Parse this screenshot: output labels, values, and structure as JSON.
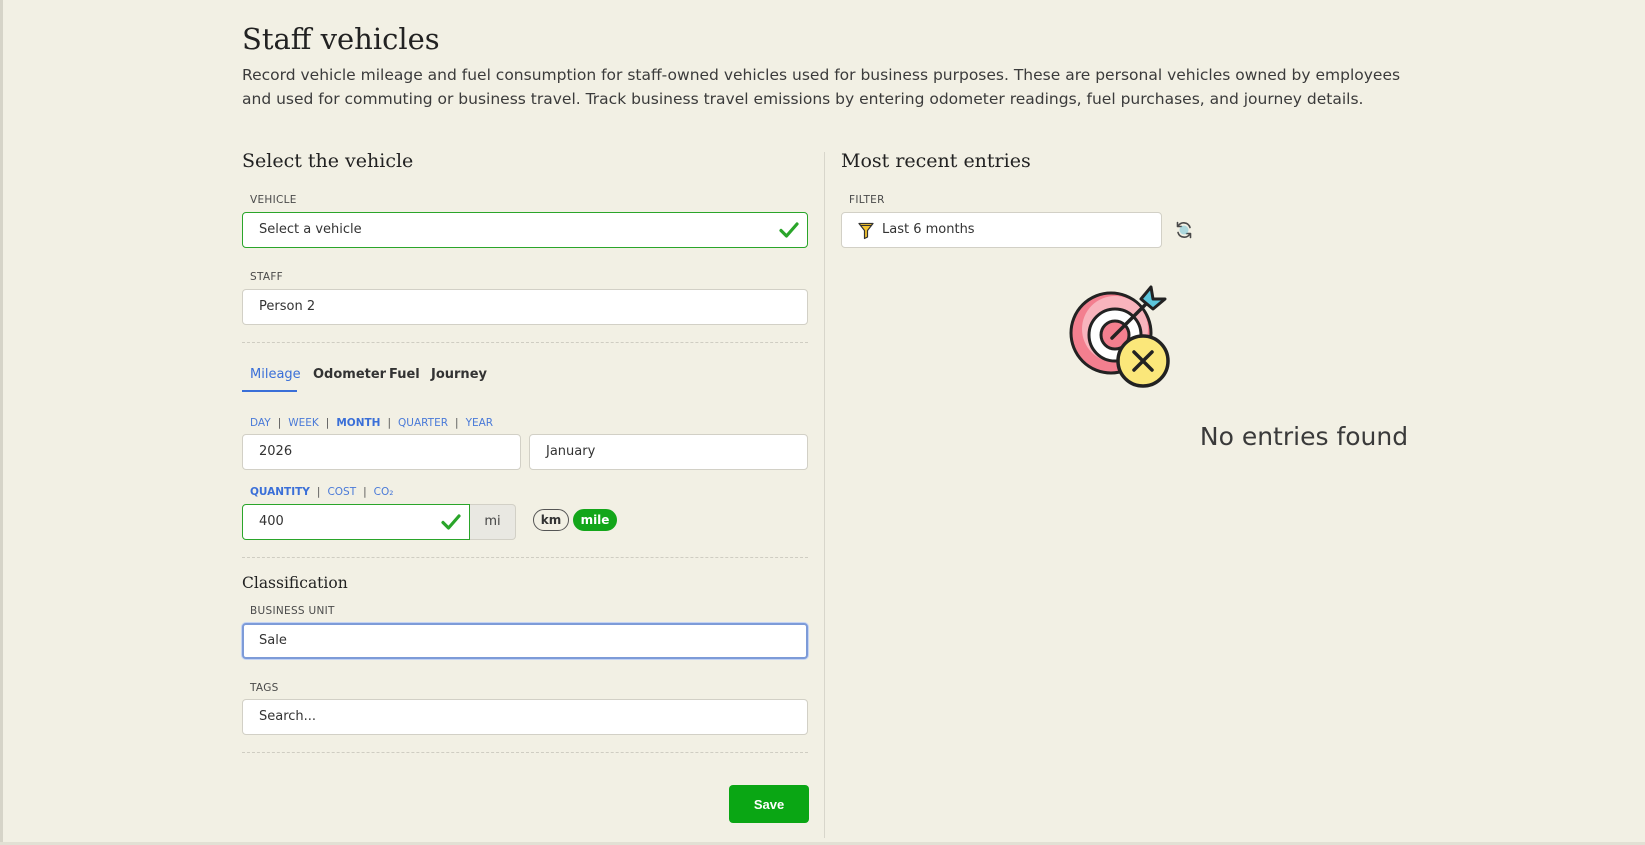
{
  "page": {
    "title": "Staff vehicles",
    "description": "Record vehicle mileage and fuel consumption for staff-owned vehicles used for business purposes. These are personal vehicles owned by employees and used for commuting or business travel. Track business travel emissions by entering odometer readings, fuel purchases, and journey details."
  },
  "form": {
    "section_title": "Select the vehicle",
    "vehicle_label": "VEHICLE",
    "vehicle_value": "Select a vehicle",
    "staff_label": "STAFF",
    "staff_value": "Person 2",
    "tabs": [
      {
        "label": "Mileage"
      },
      {
        "label": "Odometer"
      },
      {
        "label": "Fuel"
      },
      {
        "label": "Journey"
      }
    ],
    "periods": [
      "DAY",
      "WEEK",
      "MONTH",
      "QUARTER",
      "YEAR"
    ],
    "active_period": "MONTH",
    "year_value": "2026",
    "month_value": "January",
    "measures": [
      "QUANTITY",
      "COST",
      "CO₂"
    ],
    "active_measure": "QUANTITY",
    "quantity_value": "400",
    "quantity_unit": "mi",
    "distance_units": [
      "km",
      "mile"
    ],
    "active_distance_unit": "mile",
    "classification_title": "Classification",
    "business_unit_label": "BUSINESS UNIT",
    "business_unit_value": "Sale",
    "tags_label": "TAGS",
    "tags_placeholder": "Search...",
    "save_label": "Save"
  },
  "recent": {
    "title": "Most recent entries",
    "filter_label": "FILTER",
    "filter_value": "Last 6 months",
    "empty_text": "No entries found"
  },
  "icons": {
    "filter": "funnel-icon",
    "refresh": "refresh-icon",
    "empty": "target-missed-icon",
    "valid": "check-icon"
  },
  "colors": {
    "accent": "#3a6fd8",
    "success": "#0aa614",
    "background": "#f2f0e4"
  }
}
